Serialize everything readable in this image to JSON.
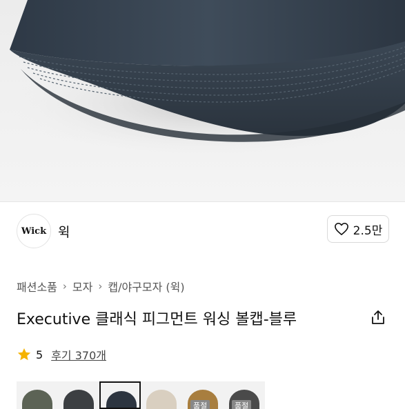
{
  "brand": {
    "name": "윅",
    "logo_text": "Wick"
  },
  "like": {
    "count": "2.5만"
  },
  "breadcrumb": [
    "패션소품",
    "모자",
    "캡/야구모자 (윅)"
  ],
  "product": {
    "title": "Executive 클래식 피그먼트 워싱 볼캡-블루"
  },
  "rating": {
    "score": "5",
    "reviews": "후기 370개"
  },
  "thumbnails": [
    {
      "color": "#5c6355",
      "label": ""
    },
    {
      "color": "#3c3f42",
      "label": ""
    },
    {
      "color": "#2d3540",
      "label": ""
    },
    {
      "color": "#d9cfc0",
      "label": ""
    },
    {
      "color": "#a87e3f",
      "label": "품절"
    },
    {
      "color": "#4a4a4a",
      "label": "품절"
    }
  ],
  "colors": {
    "cap": "#3a4654",
    "star": "#f5b301"
  }
}
